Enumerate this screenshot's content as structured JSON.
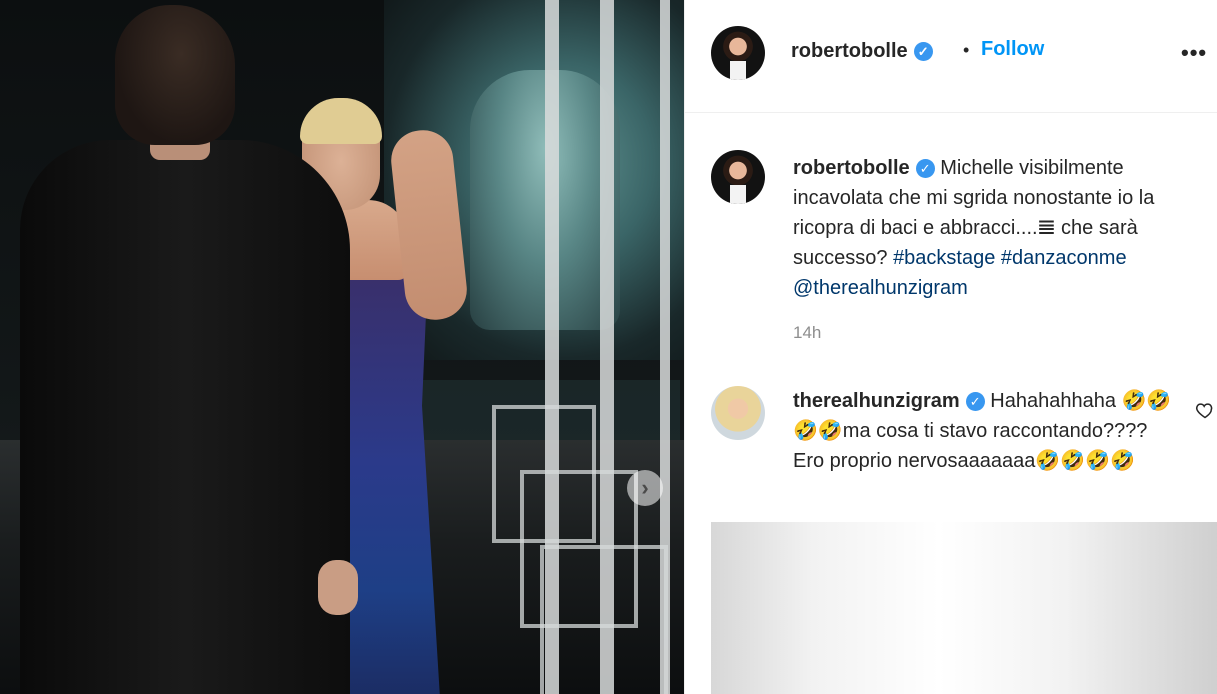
{
  "post": {
    "author": "robertobolle",
    "follow_label": "Follow",
    "dot": "•",
    "more_label": "•••",
    "caption_text": "Michelle visibilmente incavolata che mi sgrida nonostante io la ricopra di baci e abbracci....𝌆 che sarà successo?",
    "hashtags": [
      "#backstage",
      "#danzaconme"
    ],
    "mention": "@therealhunzigram",
    "time": "14h",
    "verified_mark": "✓"
  },
  "comment": {
    "author": "therealhunzigram",
    "text": "Hahahahhaha 🤣🤣🤣🤣ma cosa ti stavo raccontando???? Ero proprio nervosaaaaaaa🤣🤣🤣🤣"
  },
  "carousel": {
    "next_icon": "›"
  },
  "icons": {
    "verified": "verified-badge-icon",
    "like": "heart-icon",
    "next": "chevron-right-icon",
    "more": "more-options-icon"
  },
  "colors": {
    "link_blue": "#0095f6",
    "hashtag": "#00376b",
    "verified": "#3897f0",
    "muted": "#8e8e8e"
  }
}
